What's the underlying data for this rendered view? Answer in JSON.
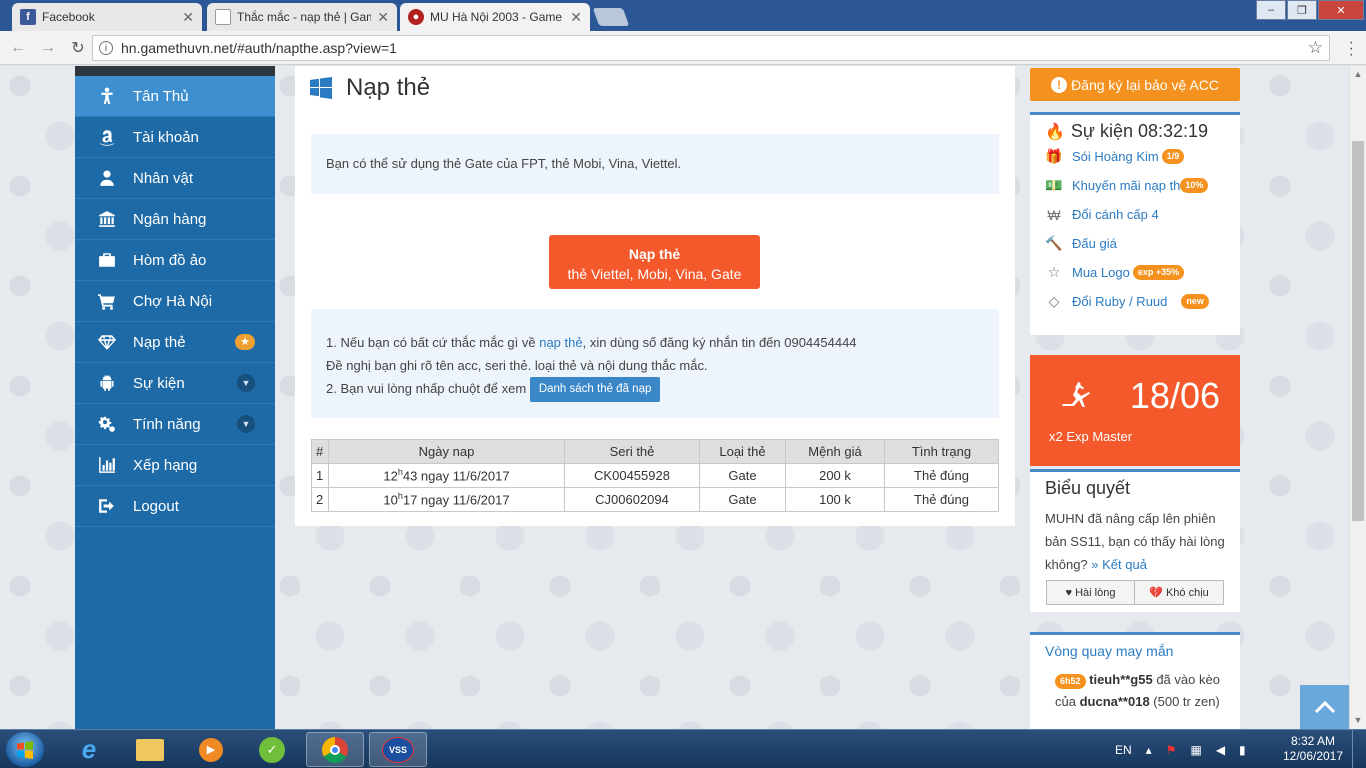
{
  "browser": {
    "tabs": [
      {
        "title": "Facebook",
        "favicon": "f",
        "active": false
      },
      {
        "title": "Thắc mắc - nạp thẻ | Gam",
        "favicon": "doc",
        "active": false
      },
      {
        "title": "MU Hà Nội 2003 - Game",
        "favicon": "mu",
        "active": true
      }
    ],
    "url": "hn.gamethuvn.net/#auth/napthe.asp?view=1",
    "window_buttons": {
      "minimize": "–",
      "restore": "❐",
      "close": "✕"
    }
  },
  "sidebar": {
    "items": [
      {
        "label": "Tân Thủ",
        "icon": "person-icon",
        "active": true
      },
      {
        "label": "Tài khoản",
        "icon": "amazon-icon"
      },
      {
        "label": "Nhân vật",
        "icon": "user-icon"
      },
      {
        "label": "Ngân hàng",
        "icon": "bank-icon"
      },
      {
        "label": "Hòm đồ ảo",
        "icon": "briefcase-icon"
      },
      {
        "label": "Chợ Hà Nội",
        "icon": "cart-icon"
      },
      {
        "label": "Nạp thẻ",
        "icon": "diamond-icon",
        "badge": "★"
      },
      {
        "label": "Sự kiện",
        "icon": "android-icon",
        "chevron": "▼"
      },
      {
        "label": "Tính năng",
        "icon": "gears-icon",
        "chevron": "▼"
      },
      {
        "label": "Xếp hạng",
        "icon": "bar-chart-icon"
      },
      {
        "label": "Logout",
        "icon": "logout-icon"
      }
    ]
  },
  "main": {
    "title": "Nạp thẻ",
    "info": "Bạn có thể sử dụng thẻ Gate của FPT, thẻ Mobi, Vina, Viettel.",
    "topup_button": {
      "line1": "Nạp thẻ",
      "line2": "thẻ Viettel, Mobi, Vina, Gate"
    },
    "help": {
      "line1_a": "1. Nếu bạn có bất cứ thắc mắc gì về ",
      "line1_link": "nạp thẻ",
      "line1_b": ", xin dùng số đăng ký nhắn tin đến 0904454444",
      "line2": "Đề nghị bạn ghi rõ tên acc, seri thẻ. loại thẻ và nội dung thắc mắc.",
      "line3": "2. Bạn vui lòng nhấp chuột để xem",
      "list_button": "Danh sách thẻ đã nạp"
    },
    "table": {
      "headers": [
        "#",
        "Ngày nap",
        "Seri thẻ",
        "Loại thẻ",
        "Mệnh giá",
        "Tình trạng"
      ],
      "rows": [
        {
          "idx": "1",
          "hour": "12",
          "sup": "h",
          "rest": "43 ngay 11/6/2017",
          "serial": "CK00455928",
          "type": "Gate",
          "value": "200 k",
          "status": "Thẻ đúng"
        },
        {
          "idx": "2",
          "hour": "10",
          "sup": "h",
          "rest": "17 ngay 11/6/2017",
          "serial": "CJ00602094",
          "type": "Gate",
          "value": "100 k",
          "status": "Thẻ đúng"
        }
      ]
    }
  },
  "right": {
    "register_button": "Đăng ký lại bảo vệ ACC",
    "events": {
      "title": "Sự kiện 08:32:19",
      "items": [
        {
          "label": "Sói Hoàng Kim",
          "pill": "1/9",
          "icon": "gift-icon",
          "glyph": "🎁"
        },
        {
          "label": "Khuyến mãi nạp th",
          "pill": "10%",
          "icon": "money-icon",
          "glyph": "💵"
        },
        {
          "label": "Đổi cánh cấp 4",
          "pill": "",
          "icon": "won-icon",
          "glyph": "₩"
        },
        {
          "label": "Đấu giá",
          "pill": "",
          "icon": "gavel-icon",
          "glyph": "🔨"
        },
        {
          "label": "Mua Logo",
          "pill": "exp +35%",
          "icon": "star-outline-icon",
          "glyph": "☆"
        },
        {
          "label": "Đổi Ruby / Ruud",
          "pill": "new",
          "icon": "diamond-outline-icon",
          "glyph": "◇"
        }
      ]
    },
    "exp_banner": {
      "date": "18/06",
      "text": "x2 Exp Master"
    },
    "vote": {
      "title": "Biểu quyết",
      "question": "MUHN đã nâng cấp lên phiên bản SS11, bạn có thấy hài lòng không?",
      "result_link": "» Kết quả",
      "options": [
        "♥ Hài lòng",
        "💔 Khó chịu"
      ]
    },
    "wheel": {
      "title": "Vòng quay may mắn",
      "time": "6h52",
      "user": "tieuh**g55",
      "text1": " đã vào kèo của ",
      "target": "ducna**018",
      "text2": " (500 tr zen)"
    }
  },
  "taskbar": {
    "lang": "EN",
    "time": "8:32 AM",
    "date": "12/06/2017"
  }
}
